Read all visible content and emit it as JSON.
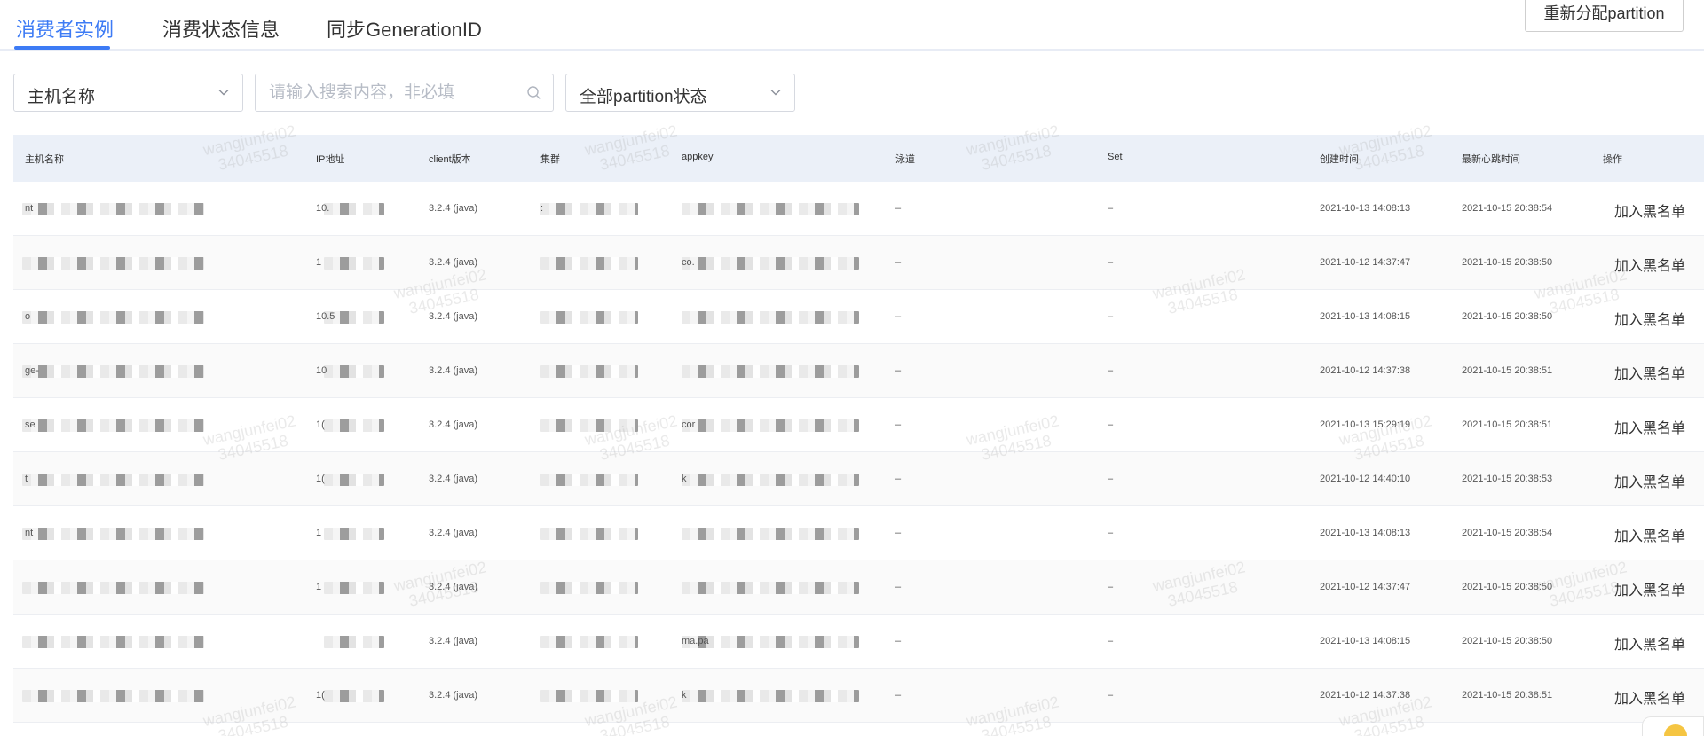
{
  "tabs": [
    {
      "label": "消费者实例",
      "active": true
    },
    {
      "label": "消费状态信息",
      "active": false
    },
    {
      "label": "同步GenerationID",
      "active": false
    }
  ],
  "reassign_button": "重新分配partition",
  "filters": {
    "host_select": "主机名称",
    "search_placeholder": "请输入搜索内容，非必填",
    "partition_select": "全部partition状态"
  },
  "table": {
    "columns": [
      "主机名称",
      "IP地址",
      "client版本",
      "集群",
      "appkey",
      "泳道",
      "Set",
      "创建时间",
      "最新心跳时间",
      "操作"
    ],
    "rows": [
      {
        "host": "nt",
        "ip": "10.",
        "version": "3.2.4 (java)",
        "cluster": ":",
        "appkey": "",
        "lane": "–",
        "set": "–",
        "created": "2021-10-13 14:08:13",
        "heartbeat": "2021-10-15 20:38:54",
        "action": "加入黑名单"
      },
      {
        "host": "",
        "ip": "1",
        "version": "3.2.4 (java)",
        "cluster": "",
        "appkey": "co.",
        "lane": "–",
        "set": "–",
        "created": "2021-10-12 14:37:47",
        "heartbeat": "2021-10-15 20:38:50",
        "action": "加入黑名单"
      },
      {
        "host": "o",
        "ip": "10.5",
        "version": "3.2.4 (java)",
        "cluster": "",
        "appkey": "",
        "lane": "–",
        "set": "–",
        "created": "2021-10-13 14:08:15",
        "heartbeat": "2021-10-15 20:38:50",
        "action": "加入黑名单"
      },
      {
        "host": "ge-",
        "ip": "10",
        "version": "3.2.4 (java)",
        "cluster": "",
        "appkey": "",
        "lane": "–",
        "set": "–",
        "created": "2021-10-12 14:37:38",
        "heartbeat": "2021-10-15 20:38:51",
        "action": "加入黑名单"
      },
      {
        "host": "se",
        "ip": "1(",
        "version": "3.2.4 (java)",
        "cluster": "",
        "appkey": "cor",
        "lane": "–",
        "set": "–",
        "created": "2021-10-13 15:29:19",
        "heartbeat": "2021-10-15 20:38:51",
        "action": "加入黑名单"
      },
      {
        "host": "t",
        "ip": "1(",
        "version": "3.2.4 (java)",
        "cluster": "",
        "appkey": "k",
        "lane": "–",
        "set": "–",
        "created": "2021-10-12 14:40:10",
        "heartbeat": "2021-10-15 20:38:53",
        "action": "加入黑名单"
      },
      {
        "host": "nt",
        "ip": "1",
        "version": "3.2.4 (java)",
        "cluster": "",
        "appkey": "",
        "lane": "–",
        "set": "–",
        "created": "2021-10-13 14:08:13",
        "heartbeat": "2021-10-15 20:38:54",
        "action": "加入黑名单"
      },
      {
        "host": "",
        "ip": "1",
        "version": "3.2.4 (java)",
        "cluster": "",
        "appkey": "",
        "lane": "–",
        "set": "–",
        "created": "2021-10-12 14:37:47",
        "heartbeat": "2021-10-15 20:38:50",
        "action": "加入黑名单"
      },
      {
        "host": "",
        "ip": "",
        "version": "3.2.4 (java)",
        "cluster": "",
        "appkey": "ma.pa",
        "lane": "–",
        "set": "–",
        "created": "2021-10-13 14:08:15",
        "heartbeat": "2021-10-15 20:38:50",
        "action": "加入黑名单"
      },
      {
        "host": "",
        "ip": "1(",
        "version": "3.2.4 (java)",
        "cluster": "",
        "appkey": "k",
        "lane": "–",
        "set": "–",
        "created": "2021-10-12 14:37:38",
        "heartbeat": "2021-10-15 20:38:51",
        "action": "加入黑名单"
      }
    ]
  },
  "watermark": {
    "name": "wangjunfei02",
    "id": "34045518"
  },
  "colors": {
    "accent": "#3d7bf5",
    "header_bg": "#ebf0f8",
    "border": "#d6d9e0"
  }
}
